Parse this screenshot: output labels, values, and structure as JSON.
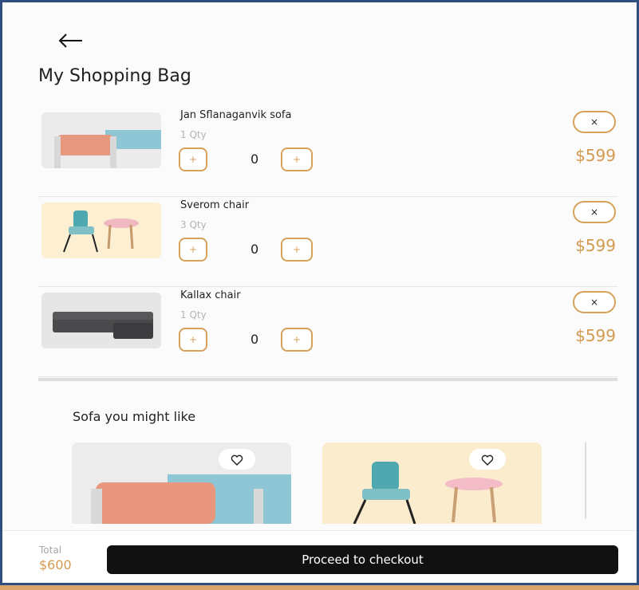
{
  "header": {
    "title": "My Shopping Bag"
  },
  "cart": {
    "items": [
      {
        "name": "Jan Sflanaganvik sofa",
        "qty": "1 Qty",
        "count": "0",
        "price": "$599",
        "minus": "+",
        "plus": "+",
        "remove": "×"
      },
      {
        "name": "Sverom chair",
        "qty": "3 Qty",
        "count": "0",
        "price": "$599",
        "minus": "+",
        "plus": "+",
        "remove": "×"
      },
      {
        "name": "Kallax chair",
        "qty": "1 Qty",
        "count": "0",
        "price": "$599",
        "minus": "+",
        "plus": "+",
        "remove": "×"
      }
    ]
  },
  "recommendations": {
    "title": "Sofa you might like"
  },
  "footer": {
    "total_label": "Total",
    "total_value": "$600",
    "checkout_label": "Proceed to checkout"
  },
  "colors": {
    "accent": "#d39a50",
    "button_dark": "#111111",
    "frame_border": "#2f4f7f"
  },
  "icons": {
    "back": "arrow-left-icon",
    "remove": "close-icon",
    "favorite": "heart-icon"
  }
}
